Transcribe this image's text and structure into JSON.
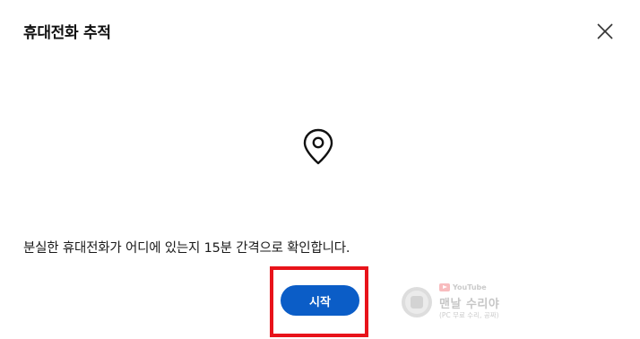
{
  "dialog": {
    "title": "휴대전화 추적",
    "description": "분실한 휴대전화가 어디에 있는지 15분 간격으로 확인합니다.",
    "start_label": "시작",
    "icons": {
      "close": "close-icon",
      "location": "location-pin-icon"
    }
  },
  "watermark": {
    "youtube_label": "YouTube",
    "main": "맨날 수리야",
    "sub": "(PC 무료 수리, 공짜)"
  },
  "colors": {
    "accent": "#0b5dc7",
    "highlight": "#e8131a"
  }
}
